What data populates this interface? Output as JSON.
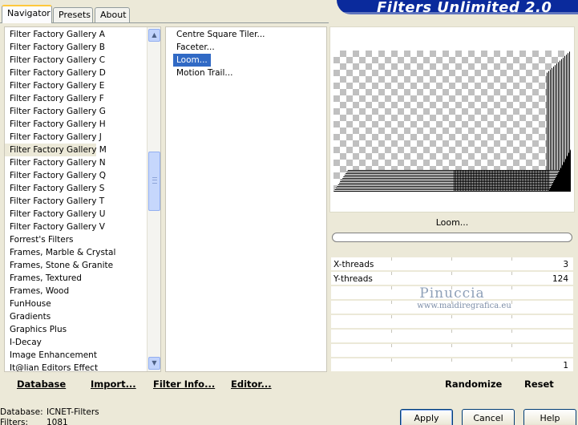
{
  "app": {
    "title": "Filters Unlimited 2.0"
  },
  "tabs": [
    {
      "label": "Navigator",
      "active": true
    },
    {
      "label": "Presets",
      "active": false
    },
    {
      "label": "About",
      "active": false
    }
  ],
  "categories": {
    "items": [
      "Filter Factory Gallery A",
      "Filter Factory Gallery B",
      "Filter Factory Gallery C",
      "Filter Factory Gallery D",
      "Filter Factory Gallery E",
      "Filter Factory Gallery F",
      "Filter Factory Gallery G",
      "Filter Factory Gallery H",
      "Filter Factory Gallery J",
      "Filter Factory Gallery M",
      "Filter Factory Gallery N",
      "Filter Factory Gallery Q",
      "Filter Factory Gallery S",
      "Filter Factory Gallery T",
      "Filter Factory Gallery U",
      "Filter Factory Gallery V",
      "Forrest's Filters",
      "Frames, Marble & Crystal",
      "Frames, Stone & Granite",
      "Frames, Textured",
      "Frames, Wood",
      "FunHouse",
      "Gradients",
      "Graphics Plus",
      "I-Decay",
      "Image Enhancement",
      "It@lian Editors Effect"
    ],
    "selected_index": 9
  },
  "filters": {
    "items": [
      "Centre Square Tiler...",
      "Faceter...",
      "Loom...",
      "Motion Trail..."
    ],
    "selected_index": 2
  },
  "left_buttons": {
    "database": "Database",
    "import": "Import...",
    "filter_info": "Filter Info...",
    "editor": "Editor..."
  },
  "preview": {
    "filter_name": "Loom..."
  },
  "params": [
    {
      "label": "X-threads",
      "value": "3"
    },
    {
      "label": "Y-threads",
      "value": "124"
    },
    {
      "label": "",
      "value": ""
    },
    {
      "label": "",
      "value": ""
    },
    {
      "label": "",
      "value": ""
    },
    {
      "label": "",
      "value": ""
    },
    {
      "label": "",
      "value": ""
    },
    {
      "label": "",
      "value": "1"
    }
  ],
  "watermark": {
    "line1": "Pinuccia",
    "line2": "www.maidiregrafica.eu"
  },
  "right_buttons": {
    "randomize": "Randomize",
    "reset": "Reset"
  },
  "status": {
    "database_label": "Database:",
    "database_value": "ICNET-Filters",
    "filters_label": "Filters:",
    "filters_value": "1081"
  },
  "dialog_buttons": {
    "apply": "Apply",
    "cancel": "Cancel",
    "help": "Help"
  }
}
